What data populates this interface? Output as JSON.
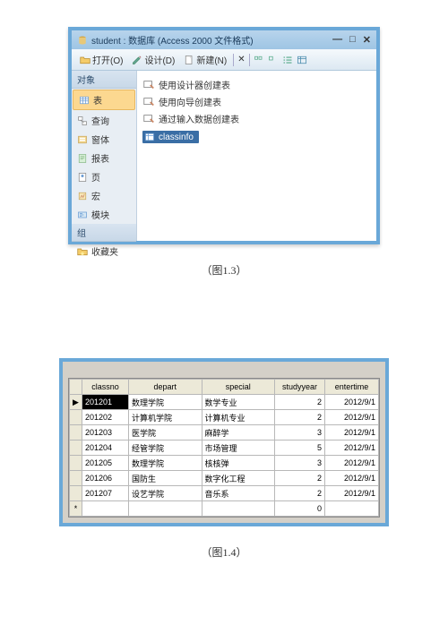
{
  "window1": {
    "title": "student : 数据库 (Access 2000 文件格式)",
    "toolbar": {
      "open": "打开(O)",
      "design": "设计(D)",
      "new": "新建(N)"
    },
    "sidebar": {
      "hdr1": "对象",
      "items": [
        "表",
        "查询",
        "窗体",
        "报表",
        "页",
        "宏",
        "模块"
      ],
      "hdr2": "组",
      "fav": "收藏夹"
    },
    "create": [
      "使用设计器创建表",
      "使用向导创建表",
      "通过输入数据创建表"
    ],
    "object": "classinfo"
  },
  "caption1": "（图1.3）",
  "caption2": "（图1.4）",
  "table": {
    "headers": [
      "classno",
      "depart",
      "special",
      "studyyear",
      "entertime"
    ],
    "rows": [
      [
        "201201",
        "数理学院",
        "数学专业",
        "2",
        "2012/9/1"
      ],
      [
        "201202",
        "计算机学院",
        "计算机专业",
        "2",
        "2012/9/1"
      ],
      [
        "201203",
        "医学院",
        "麻醉学",
        "3",
        "2012/9/1"
      ],
      [
        "201204",
        "经管学院",
        "市场管理",
        "5",
        "2012/9/1"
      ],
      [
        "201205",
        "数理学院",
        "核核弹",
        "3",
        "2012/9/1"
      ],
      [
        "201206",
        "国防生",
        "数字化工程",
        "2",
        "2012/9/1"
      ],
      [
        "201207",
        "设艺学院",
        "音乐系",
        "2",
        "2012/9/1"
      ]
    ]
  }
}
